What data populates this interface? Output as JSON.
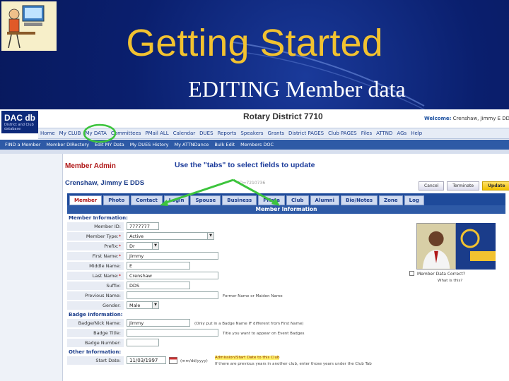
{
  "slide": {
    "title": "Getting Started",
    "subtitle": "EDITING Member data"
  },
  "app": {
    "logo_main": "DAC db",
    "logo_sub": "District and Club database",
    "district_title": "Rotary District 7710",
    "welcome_label": "Welcome:",
    "welcome_user": "Crenshaw, Jimmy E DDS"
  },
  "nav": {
    "items": [
      "Home",
      "My CLUB",
      "My DATA",
      "Committees",
      "PMail ALL",
      "Calendar",
      "DUES",
      "Reports",
      "Speakers",
      "Grants",
      "District PAGES",
      "Club PAGES",
      "Files",
      "ATTND",
      "AGs",
      "Help"
    ]
  },
  "subnav": {
    "items": [
      "FIND a Member",
      "Member DIRectory",
      "Edit MY Data",
      "My DUES History",
      "My ATTNDance",
      "Bulk Edit",
      "Members DOC"
    ]
  },
  "panel": {
    "heading": "Member Admin",
    "callout": "Use the \"tabs\" to select fields to update",
    "member_name": "Crenshaw, Jimmy E DDS",
    "faint_id": "ID=7210736",
    "buttons": {
      "cancel": "Cancel",
      "terminate": "Terminate",
      "update": "Update"
    },
    "tabs": [
      "Member",
      "Photo",
      "Contact",
      "Login",
      "Spouse",
      "Business",
      "PHata",
      "Club",
      "Alumni",
      "Bio/Notes",
      "Zone",
      "Log"
    ],
    "active_tab": "Member",
    "section_title": "Member Information"
  },
  "form": {
    "member_info_label": "Member Information:",
    "badge_info_label": "Badge Information:",
    "other_info_label": "Other Information:",
    "fields": {
      "member_id": {
        "label": "Member ID:",
        "value": "7777777"
      },
      "member_type": {
        "label": "Member Type:",
        "value": "Active"
      },
      "prefix": {
        "label": "Prefix:",
        "value": "Dr"
      },
      "first_name": {
        "label": "First Name:",
        "value": "Jimmy"
      },
      "middle_name": {
        "label": "Middle Name:",
        "value": "E"
      },
      "last_name": {
        "label": "Last Name:",
        "value": "Crenshaw"
      },
      "suffix": {
        "label": "Suffix:",
        "value": "DDS"
      },
      "previous_name": {
        "label": "Previous Name:",
        "value": ""
      },
      "gender": {
        "label": "Gender:",
        "value": "Male"
      },
      "badge_nick": {
        "label": "Badge/Nick Name:",
        "value": "Jimmy"
      },
      "badge_title": {
        "label": "Badge Title:",
        "value": ""
      },
      "badge_number": {
        "label": "Badge Number:",
        "value": ""
      },
      "start_date": {
        "label": "Start Date:",
        "value": "11/03/1997"
      }
    },
    "hints": {
      "previous_name": "Former Name or Maiden Name",
      "badge_nick": "(Only put in a Badge Name IF different from First Name)",
      "badge_title": "Title you want to appear on Event Badges",
      "date_format": "(mm/dd/yyyy)",
      "start_date_hl": "Admission/Start Date to this Club",
      "start_date_more": "If there are previous years in another club, enter those years under the Club Tab"
    },
    "data_correct_label": "Member Data Correct?",
    "what_is_this": "What is this?"
  },
  "colors": {
    "slide_bg": "#0a1f6e",
    "title_gold": "#f2c230",
    "nav_blue": "#2e5aa6",
    "admin_red": "#b01818",
    "highlight_green": "#3cc43c"
  }
}
